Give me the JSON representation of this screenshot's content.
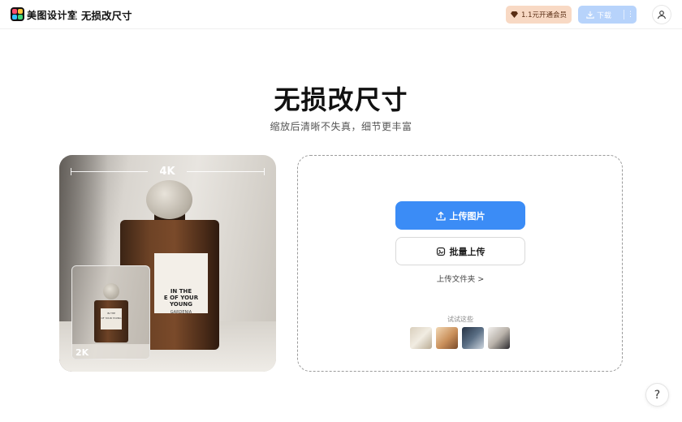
{
  "header": {
    "brand": "美图设计室",
    "tool_title": "无损改尺寸",
    "vip_label": "1.1元开通会员",
    "download_label": "下载",
    "download_more": "⋮"
  },
  "hero": {
    "title": "无损改尺寸",
    "subtitle": "缩放后清晰不失真，细节更丰富"
  },
  "preview": {
    "tag_large": "4K",
    "tag_small": "2K",
    "label_line1": "IN THE",
    "label_line2": "E  OF YOUR YOUNG",
    "label_line3": "GARDENIA",
    "inset_line1": "IN THE",
    "inset_line2": "OF YOUR YOUNG"
  },
  "upload": {
    "primary_button": "上传图片",
    "secondary_button": "批量上传",
    "folder_link": "上传文件夹 >",
    "try_label": "试试这些"
  },
  "help_label": "?",
  "colors": {
    "primary": "#3b8cf6",
    "vip_bg": "#f8d9c4",
    "download_bg": "#b7d3fb"
  },
  "icons": [
    "logo-icon",
    "diamond-icon",
    "download-icon",
    "more-icon",
    "user-icon",
    "upload-icon",
    "batch-upload-icon",
    "help-icon"
  ]
}
